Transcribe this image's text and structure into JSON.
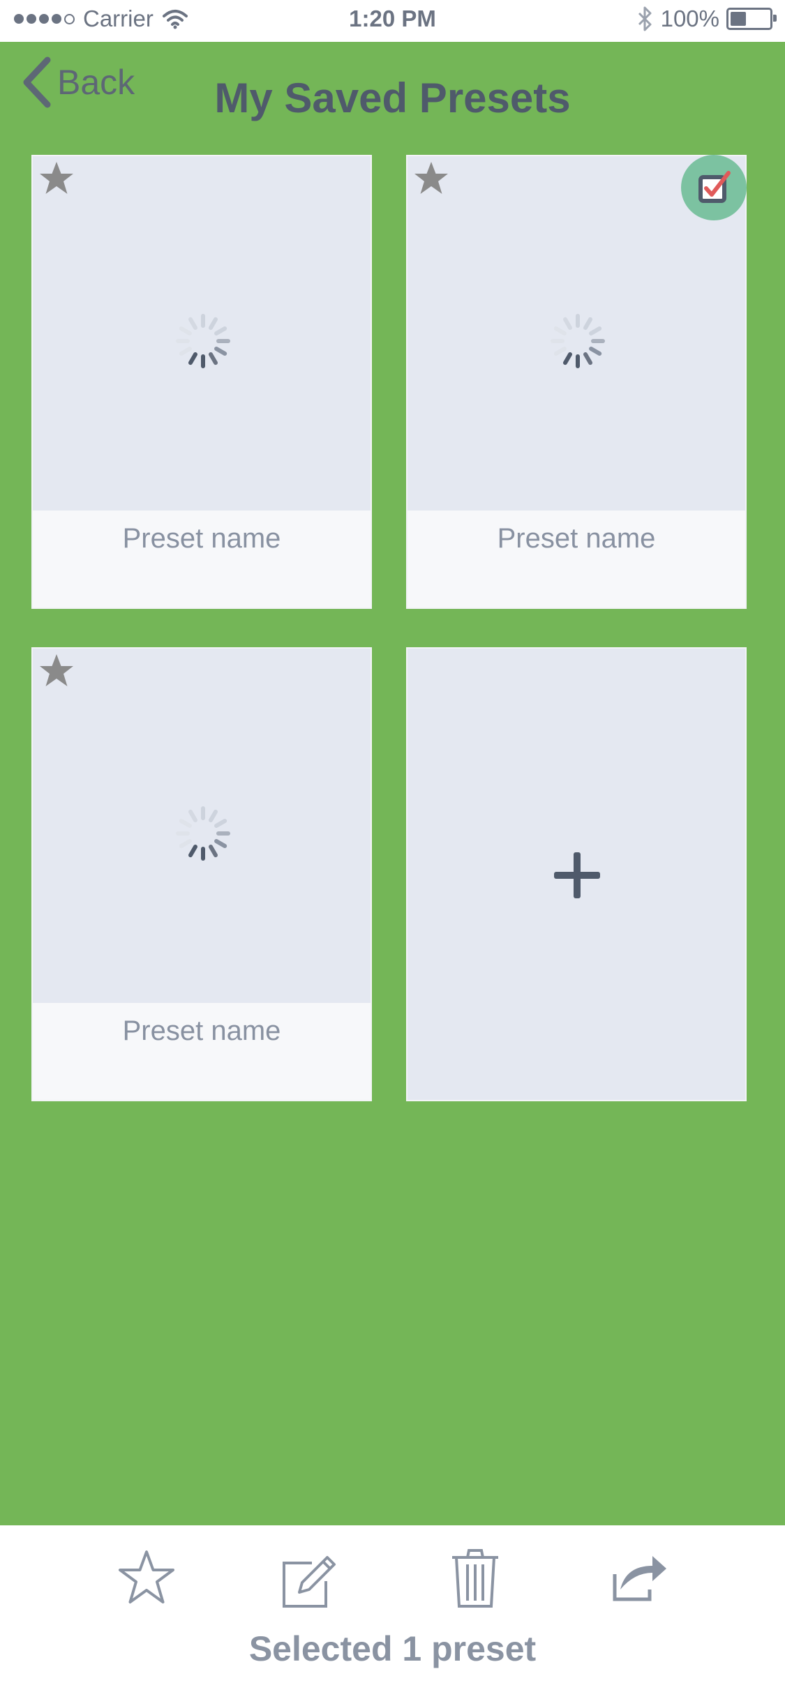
{
  "status_bar": {
    "carrier": "Carrier",
    "time": "1:20 PM",
    "battery": "100%"
  },
  "header": {
    "back_label": "Back",
    "title": "My Saved Presets"
  },
  "presets": [
    {
      "name": "Preset name",
      "favorite": true,
      "selected": false
    },
    {
      "name": "Preset name",
      "favorite": true,
      "selected": true
    },
    {
      "name": "Preset name",
      "favorite": true,
      "selected": false
    }
  ],
  "toolbar": {
    "icons": [
      "star-icon",
      "edit-icon",
      "trash-icon",
      "share-icon"
    ],
    "selection_status": "Selected 1 preset"
  },
  "colors": {
    "background": "#74b657",
    "card": "#e4e8f1",
    "card_footer": "#f7f8fa",
    "select_badge": "#7cc2a1",
    "check_mark": "#e05a5a",
    "text_dark": "#4f5a6b"
  }
}
